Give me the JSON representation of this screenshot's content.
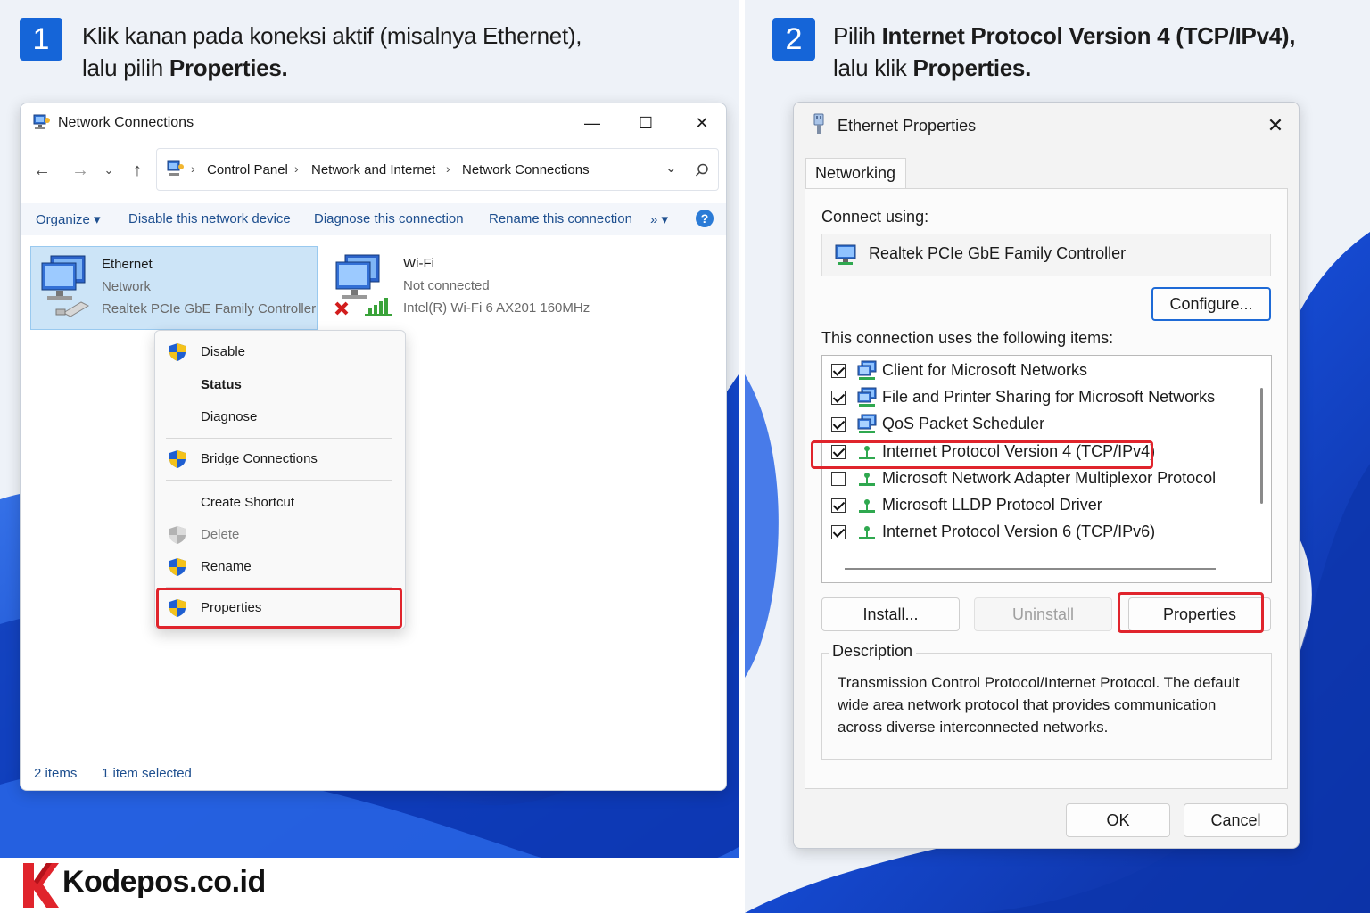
{
  "steps": [
    {
      "number": "1",
      "line1": "Klik kanan pada koneksi aktif (misalnya Ethernet),",
      "line2_prefix": "lalu pilih ",
      "line2_bold": "Properties."
    },
    {
      "number": "2",
      "line1_prefix": "Pilih ",
      "line1_bold": "Internet Protocol Version 4 (TCP/IPv4),",
      "line2_prefix": "lalu klik ",
      "line2_bold": "Properties."
    }
  ],
  "network_connections": {
    "title": "Network Connections",
    "window_controls": {
      "minimize": "—",
      "maximize": "☐",
      "close": "✕"
    },
    "breadcrumb": [
      "Control Panel",
      "Network and Internet",
      "Network Connections"
    ],
    "commands": [
      "Organize ▾",
      "Disable this network device",
      "Diagnose this connection",
      "Rename this connection",
      "» ▾"
    ],
    "help": "?",
    "items": [
      {
        "name": "Ethernet",
        "status": "Network",
        "device": "Realtek PCIe GbE Family Controller",
        "selected": true,
        "icon": "ethernet-adapter-icon"
      },
      {
        "name": "Wi-Fi",
        "status": "Not connected",
        "device": "Intel(R) Wi-Fi 6 AX201 160MHz",
        "selected": false,
        "icon": "wifi-adapter-icon"
      }
    ],
    "status_left": "2 items",
    "status_right": "1 item selected",
    "context_menu": [
      {
        "label": "Disable",
        "icon": "shield-icon"
      },
      {
        "label": "Status",
        "bold": true
      },
      {
        "label": "Diagnose"
      },
      {
        "label": "Bridge Connections",
        "icon": "shield-icon"
      },
      {
        "label": "Create Shortcut"
      },
      {
        "label": "Delete",
        "icon": "shield-gray-icon",
        "disabled": true
      },
      {
        "label": "Rename",
        "icon": "shield-icon"
      },
      {
        "label": "Properties",
        "icon": "shield-icon",
        "highlighted": true
      }
    ]
  },
  "ethernet_properties": {
    "title": "Ethernet Properties",
    "close": "✕",
    "tab": "Networking",
    "connect_using_label": "Connect using:",
    "adapter": "Realtek PCIe GbE Family Controller",
    "configure": "Configure...",
    "items_label": "This connection uses the following items:",
    "items": [
      {
        "label": "Client for Microsoft Networks",
        "checked": true,
        "icon": "network-client-icon"
      },
      {
        "label": "File and Printer Sharing for Microsoft Networks",
        "checked": true,
        "icon": "network-client-icon"
      },
      {
        "label": "QoS Packet Scheduler",
        "checked": true,
        "icon": "network-client-icon"
      },
      {
        "label": "Internet Protocol Version 4 (TCP/IPv4)",
        "checked": true,
        "icon": "protocol-icon",
        "highlighted": true
      },
      {
        "label": "Microsoft Network Adapter Multiplexor Protocol",
        "checked": false,
        "icon": "protocol-icon"
      },
      {
        "label": "Microsoft LLDP Protocol Driver",
        "checked": true,
        "icon": "protocol-icon"
      },
      {
        "label": "Internet Protocol Version 6 (TCP/IPv6)",
        "checked": true,
        "icon": "protocol-icon"
      }
    ],
    "buttons": {
      "install": "Install...",
      "uninstall": "Uninstall",
      "properties": "Properties"
    },
    "description_label": "Description",
    "description": "Transmission Control Protocol/Internet Protocol. The default wide area network protocol that provides communication across diverse interconnected networks.",
    "ok": "OK",
    "cancel": "Cancel"
  },
  "brand": {
    "name": "Kodepos.co.id"
  },
  "colors": {
    "accent": "#1565d8",
    "highlight": "#e0242c",
    "selection": "#cce4f7",
    "link": "#1e4f8f"
  }
}
